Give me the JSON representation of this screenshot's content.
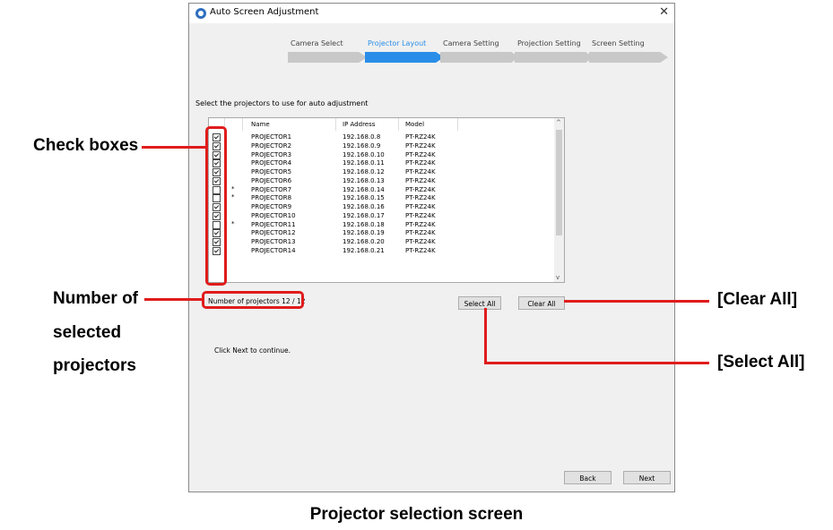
{
  "window": {
    "title": "Auto Screen Adjustment",
    "close_glyph": "✕",
    "icon": "app-logo-icon"
  },
  "steps": [
    {
      "label": "Camera Select",
      "active": false
    },
    {
      "label": "Projector Layout",
      "active": true
    },
    {
      "label": "Camera Setting",
      "active": false
    },
    {
      "label": "Projection Setting",
      "active": false
    },
    {
      "label": "Screen Setting",
      "active": false
    }
  ],
  "instruction": "Select the projectors to use for auto adjustment",
  "table": {
    "columns": [
      "Name",
      "IP Address",
      "Model"
    ],
    "rows": [
      {
        "checked": true,
        "mark": "",
        "name": "PROJECTOR1",
        "ip": "192.168.0.8",
        "model": "PT-RZ24K"
      },
      {
        "checked": true,
        "mark": "",
        "name": "PROJECTOR2",
        "ip": "192.168.0.9",
        "model": "PT-RZ24K"
      },
      {
        "checked": true,
        "mark": "",
        "name": "PROJECTOR3",
        "ip": "192.168.0.10",
        "model": "PT-RZ24K"
      },
      {
        "checked": true,
        "mark": "",
        "name": "PROJECTOR4",
        "ip": "192.168.0.11",
        "model": "PT-RZ24K"
      },
      {
        "checked": true,
        "mark": "",
        "name": "PROJECTOR5",
        "ip": "192.168.0.12",
        "model": "PT-RZ24K"
      },
      {
        "checked": true,
        "mark": "",
        "name": "PROJECTOR6",
        "ip": "192.168.0.13",
        "model": "PT-RZ24K"
      },
      {
        "checked": false,
        "mark": "*",
        "name": "PROJECTOR7",
        "ip": "192.168.0.14",
        "model": "PT-RZ24K"
      },
      {
        "checked": false,
        "mark": "*",
        "name": "PROJECTOR8",
        "ip": "192.168.0.15",
        "model": "PT-RZ24K"
      },
      {
        "checked": true,
        "mark": "",
        "name": "PROJECTOR9",
        "ip": "192.168.0.16",
        "model": "PT-RZ24K"
      },
      {
        "checked": true,
        "mark": "",
        "name": "PROJECTOR10",
        "ip": "192.168.0.17",
        "model": "PT-RZ24K"
      },
      {
        "checked": false,
        "mark": "*",
        "name": "PROJECTOR11",
        "ip": "192.168.0.18",
        "model": "PT-RZ24K"
      },
      {
        "checked": true,
        "mark": "",
        "name": "PROJECTOR12",
        "ip": "192.168.0.19",
        "model": "PT-RZ24K"
      },
      {
        "checked": true,
        "mark": "",
        "name": "PROJECTOR13",
        "ip": "192.168.0.20",
        "model": "PT-RZ24K"
      },
      {
        "checked": true,
        "mark": "",
        "name": "PROJECTOR14",
        "ip": "192.168.0.21",
        "model": "PT-RZ24K"
      }
    ]
  },
  "count_text": "Number of projectors  12 / 12",
  "buttons": {
    "select_all": "Select All",
    "clear_all": "Clear All",
    "back": "Back",
    "next": "Next"
  },
  "message": "Click Next to continue.",
  "callouts": {
    "check_boxes": "Check boxes",
    "number_line1": "Number of",
    "number_line2": "selected",
    "number_line3": "projectors",
    "clear_all": "[Clear All]",
    "select_all": "[Select All]"
  },
  "caption": "Projector selection screen",
  "colors": {
    "accent": "#2a8ee8",
    "highlight": "#e01c1c"
  }
}
